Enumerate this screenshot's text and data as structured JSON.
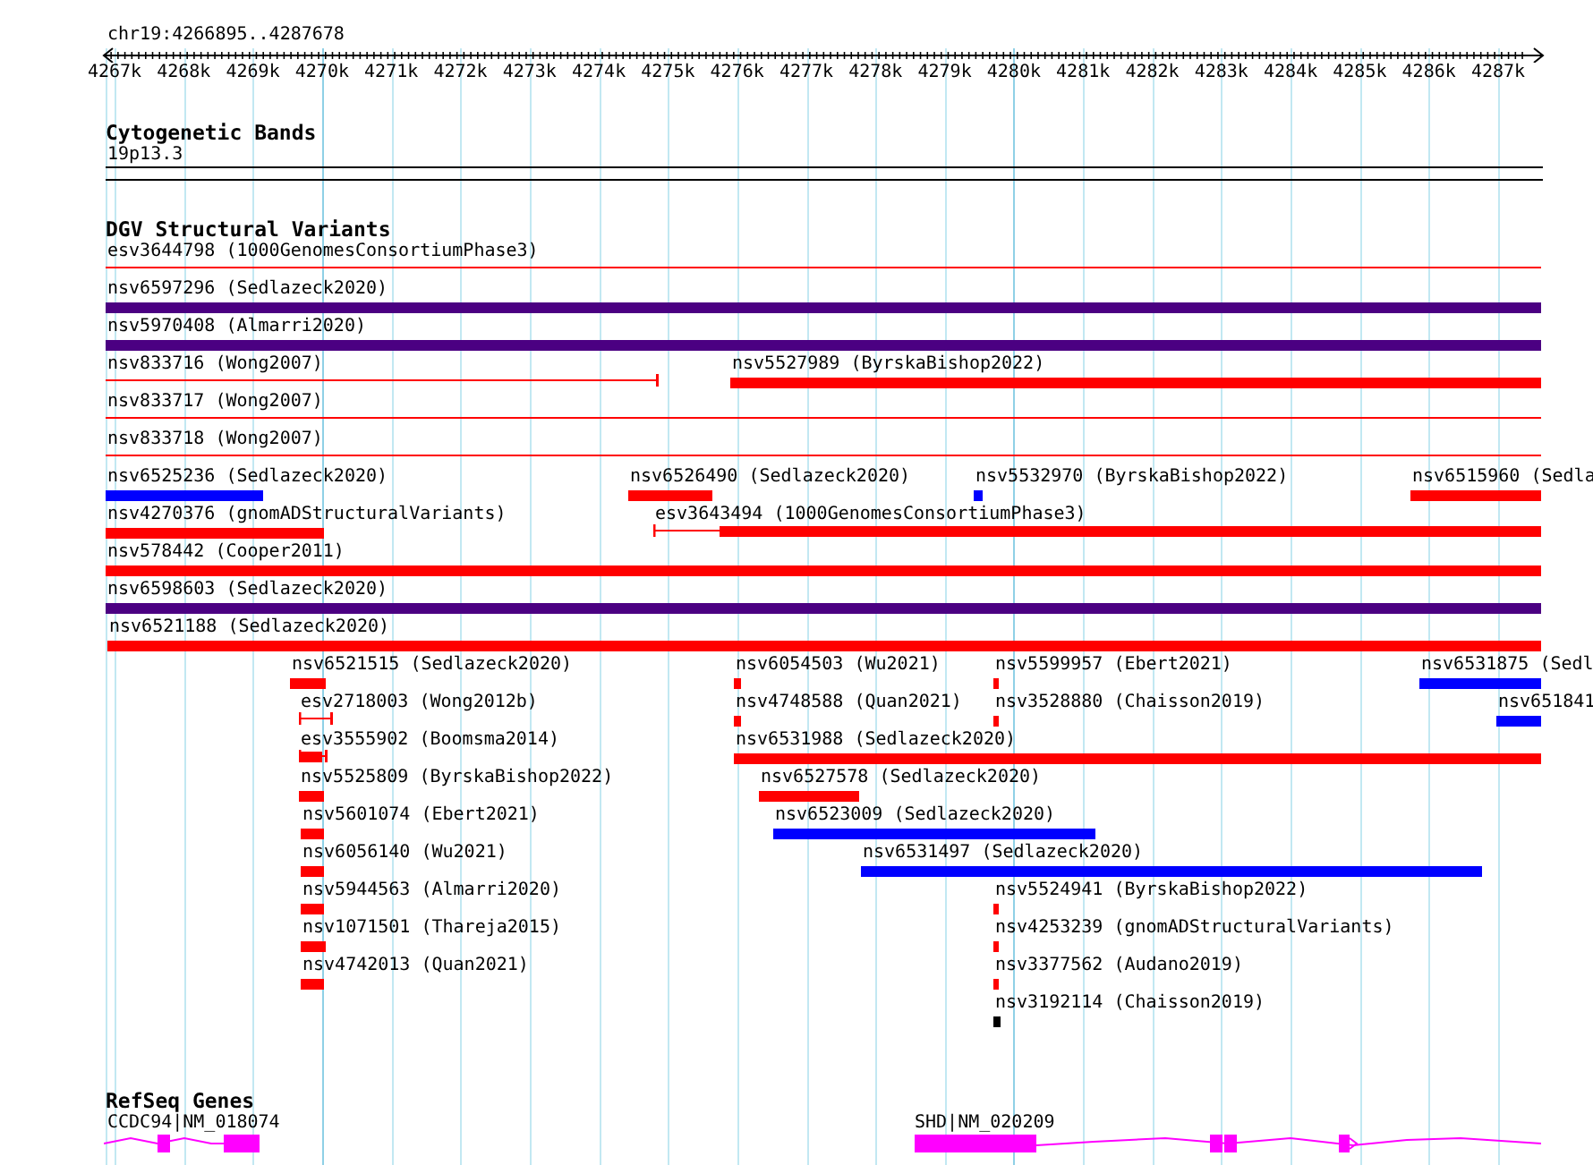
{
  "ruler": {
    "location": "chr19:4266895..4287678",
    "ticks": [
      "4267k",
      "4268k",
      "4269k",
      "4270k",
      "4271k",
      "4272k",
      "4273k",
      "4274k",
      "4275k",
      "4276k",
      "4277k",
      "4278k",
      "4279k",
      "4280k",
      "4281k",
      "4282k",
      "4283k",
      "4284k",
      "4285k",
      "4286k",
      "4287k"
    ]
  },
  "cytoband_track": {
    "title": "Cytogenetic Bands",
    "band": "19p13.3"
  },
  "dgv_track": {
    "title": "DGV Structural Variants",
    "rows": [
      {
        "features": [
          {
            "label": "esv3644798 (1000GenomesConsortiumPhase3)",
            "kind": "line",
            "color": "#ff0000"
          }
        ]
      },
      {
        "features": [
          {
            "label": "nsv6597296 (Sedlazeck2020)",
            "kind": "bar",
            "color": "#4b0082"
          }
        ]
      },
      {
        "features": [
          {
            "label": "nsv5970408 (Almarri2020)",
            "kind": "bar",
            "color": "#4b0082"
          }
        ]
      },
      {
        "features": [
          {
            "label": "nsv833716 (Wong2007)",
            "kind": "whisker",
            "color": "#ff0000"
          },
          {
            "label": "nsv5527989 (ByrskaBishop2022)",
            "kind": "bar",
            "color": "#ff0000"
          }
        ]
      },
      {
        "features": [
          {
            "label": "nsv833717 (Wong2007)",
            "kind": "line",
            "color": "#ff0000"
          }
        ]
      },
      {
        "features": [
          {
            "label": "nsv833718 (Wong2007)",
            "kind": "line",
            "color": "#ff0000"
          }
        ]
      },
      {
        "features": [
          {
            "label": "nsv6525236 (Sedlazeck2020)",
            "kind": "bar",
            "color": "#0000ff"
          },
          {
            "label": "nsv6526490 (Sedlazeck2020)",
            "kind": "bar",
            "color": "#ff0000"
          },
          {
            "label": "nsv5532970 (ByrskaBishop2022)",
            "kind": "bar",
            "color": "#0000ff"
          },
          {
            "label": "nsv6515960 (Sedla",
            "kind": "bar",
            "color": "#ff0000"
          }
        ]
      },
      {
        "features": [
          {
            "label": "nsv4270376 (gnomADStructuralVariants)",
            "kind": "bar",
            "color": "#ff0000"
          },
          {
            "label": "esv3643494 (1000GenomesConsortiumPhase3)",
            "kind": "whisker",
            "color": "#ff0000"
          }
        ]
      },
      {
        "features": [
          {
            "label": "nsv578442 (Cooper2011)",
            "kind": "bar",
            "color": "#ff0000"
          }
        ]
      },
      {
        "features": [
          {
            "label": "nsv6598603 (Sedlazeck2020)",
            "kind": "bar",
            "color": "#4b0082"
          }
        ]
      },
      {
        "features": [
          {
            "label": "nsv6521188 (Sedlazeck2020)",
            "kind": "bar",
            "color": "#ff0000"
          }
        ]
      },
      {
        "features": [
          {
            "label": "nsv6521515 (Sedlazeck2020)",
            "kind": "bar",
            "color": "#ff0000"
          },
          {
            "label": "nsv6054503 (Wu2021)",
            "kind": "bar",
            "color": "#ff0000"
          },
          {
            "label": "nsv5599957 (Ebert2021)",
            "kind": "bar",
            "color": "#ff0000"
          },
          {
            "label": "nsv6531875 (Sedl",
            "kind": "bar",
            "color": "#0000ff"
          }
        ]
      },
      {
        "features": [
          {
            "label": "esv2718003 (Wong2012b)",
            "kind": "whisker",
            "color": "#ff0000"
          },
          {
            "label": "nsv4748588 (Quan2021)",
            "kind": "bar",
            "color": "#ff0000"
          },
          {
            "label": "nsv3528880 (Chaisson2019)",
            "kind": "bar",
            "color": "#ff0000"
          },
          {
            "label": "nsv651841",
            "kind": "bar",
            "color": "#0000ff"
          }
        ]
      },
      {
        "features": [
          {
            "label": "esv3555902 (Boomsma2014)",
            "kind": "whisker",
            "color": "#ff0000"
          },
          {
            "label": "nsv6531988 (Sedlazeck2020)",
            "kind": "bar",
            "color": "#ff0000"
          }
        ]
      },
      {
        "features": [
          {
            "label": "nsv5525809 (ByrskaBishop2022)",
            "kind": "bar",
            "color": "#ff0000"
          },
          {
            "label": "nsv6527578 (Sedlazeck2020)",
            "kind": "bar",
            "color": "#ff0000"
          }
        ]
      },
      {
        "features": [
          {
            "label": "nsv5601074 (Ebert2021)",
            "kind": "bar",
            "color": "#ff0000"
          },
          {
            "label": "nsv6523009 (Sedlazeck2020)",
            "kind": "bar",
            "color": "#0000ff"
          }
        ]
      },
      {
        "features": [
          {
            "label": "nsv6056140 (Wu2021)",
            "kind": "bar",
            "color": "#ff0000"
          },
          {
            "label": "nsv6531497 (Sedlazeck2020)",
            "kind": "bar",
            "color": "#0000ff"
          }
        ]
      },
      {
        "features": [
          {
            "label": "nsv5944563 (Almarri2020)",
            "kind": "bar",
            "color": "#ff0000"
          },
          {
            "label": "nsv5524941 (ByrskaBishop2022)",
            "kind": "bar",
            "color": "#ff0000"
          }
        ]
      },
      {
        "features": [
          {
            "label": "nsv1071501 (Thareja2015)",
            "kind": "bar",
            "color": "#ff0000"
          },
          {
            "label": "nsv4253239 (gnomADStructuralVariants)",
            "kind": "bar",
            "color": "#ff0000"
          }
        ]
      },
      {
        "features": [
          {
            "label": "nsv4742013 (Quan2021)",
            "kind": "bar",
            "color": "#ff0000"
          },
          {
            "label": "nsv3377562 (Audano2019)",
            "kind": "bar",
            "color": "#ff0000"
          }
        ]
      },
      {
        "features": [
          {
            "label": "nsv3192114 (Chaisson2019)",
            "kind": "bar",
            "color": "#000000"
          }
        ]
      }
    ]
  },
  "refseq_track": {
    "title": "RefSeq Genes",
    "genes": [
      {
        "label": "CCDC94|NM_018074"
      },
      {
        "label": "SHD|NM_020209"
      }
    ]
  }
}
